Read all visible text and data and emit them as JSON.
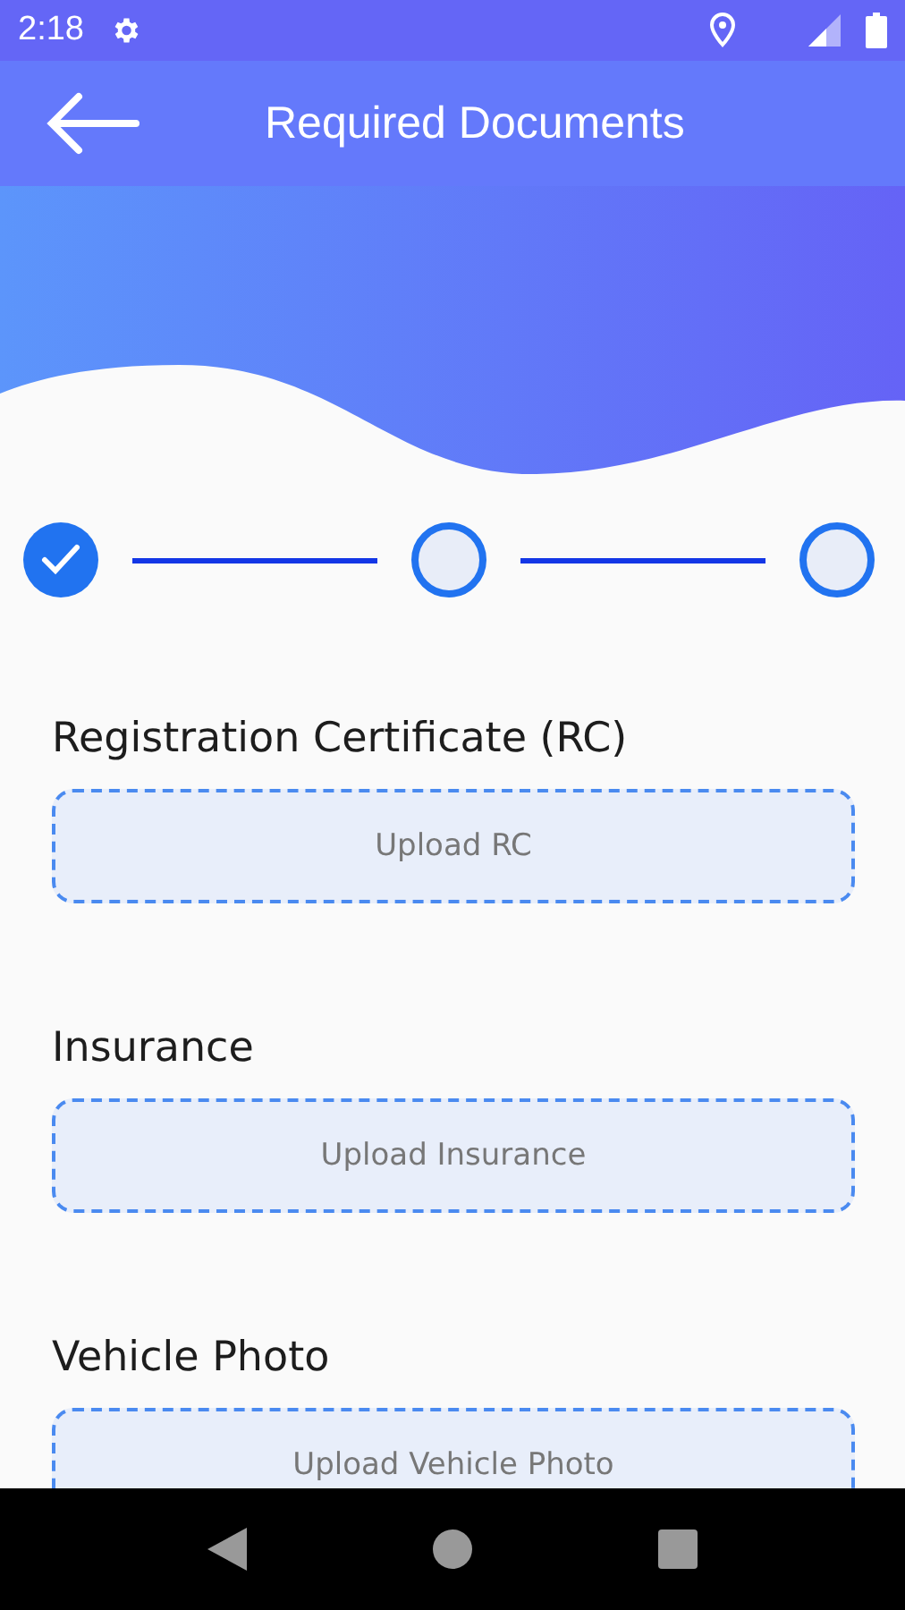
{
  "status_bar": {
    "time": "2:18"
  },
  "app_bar": {
    "title": "Required Documents"
  },
  "steps": [
    {
      "done": true
    },
    {
      "done": false
    },
    {
      "done": false
    }
  ],
  "documents": [
    {
      "label": "Registration Certificate (RC)",
      "button": "Upload RC"
    },
    {
      "label": "Insurance",
      "button": "Upload Insurance"
    },
    {
      "label": "Vehicle Photo",
      "button": "Upload Vehicle Photo"
    }
  ]
}
